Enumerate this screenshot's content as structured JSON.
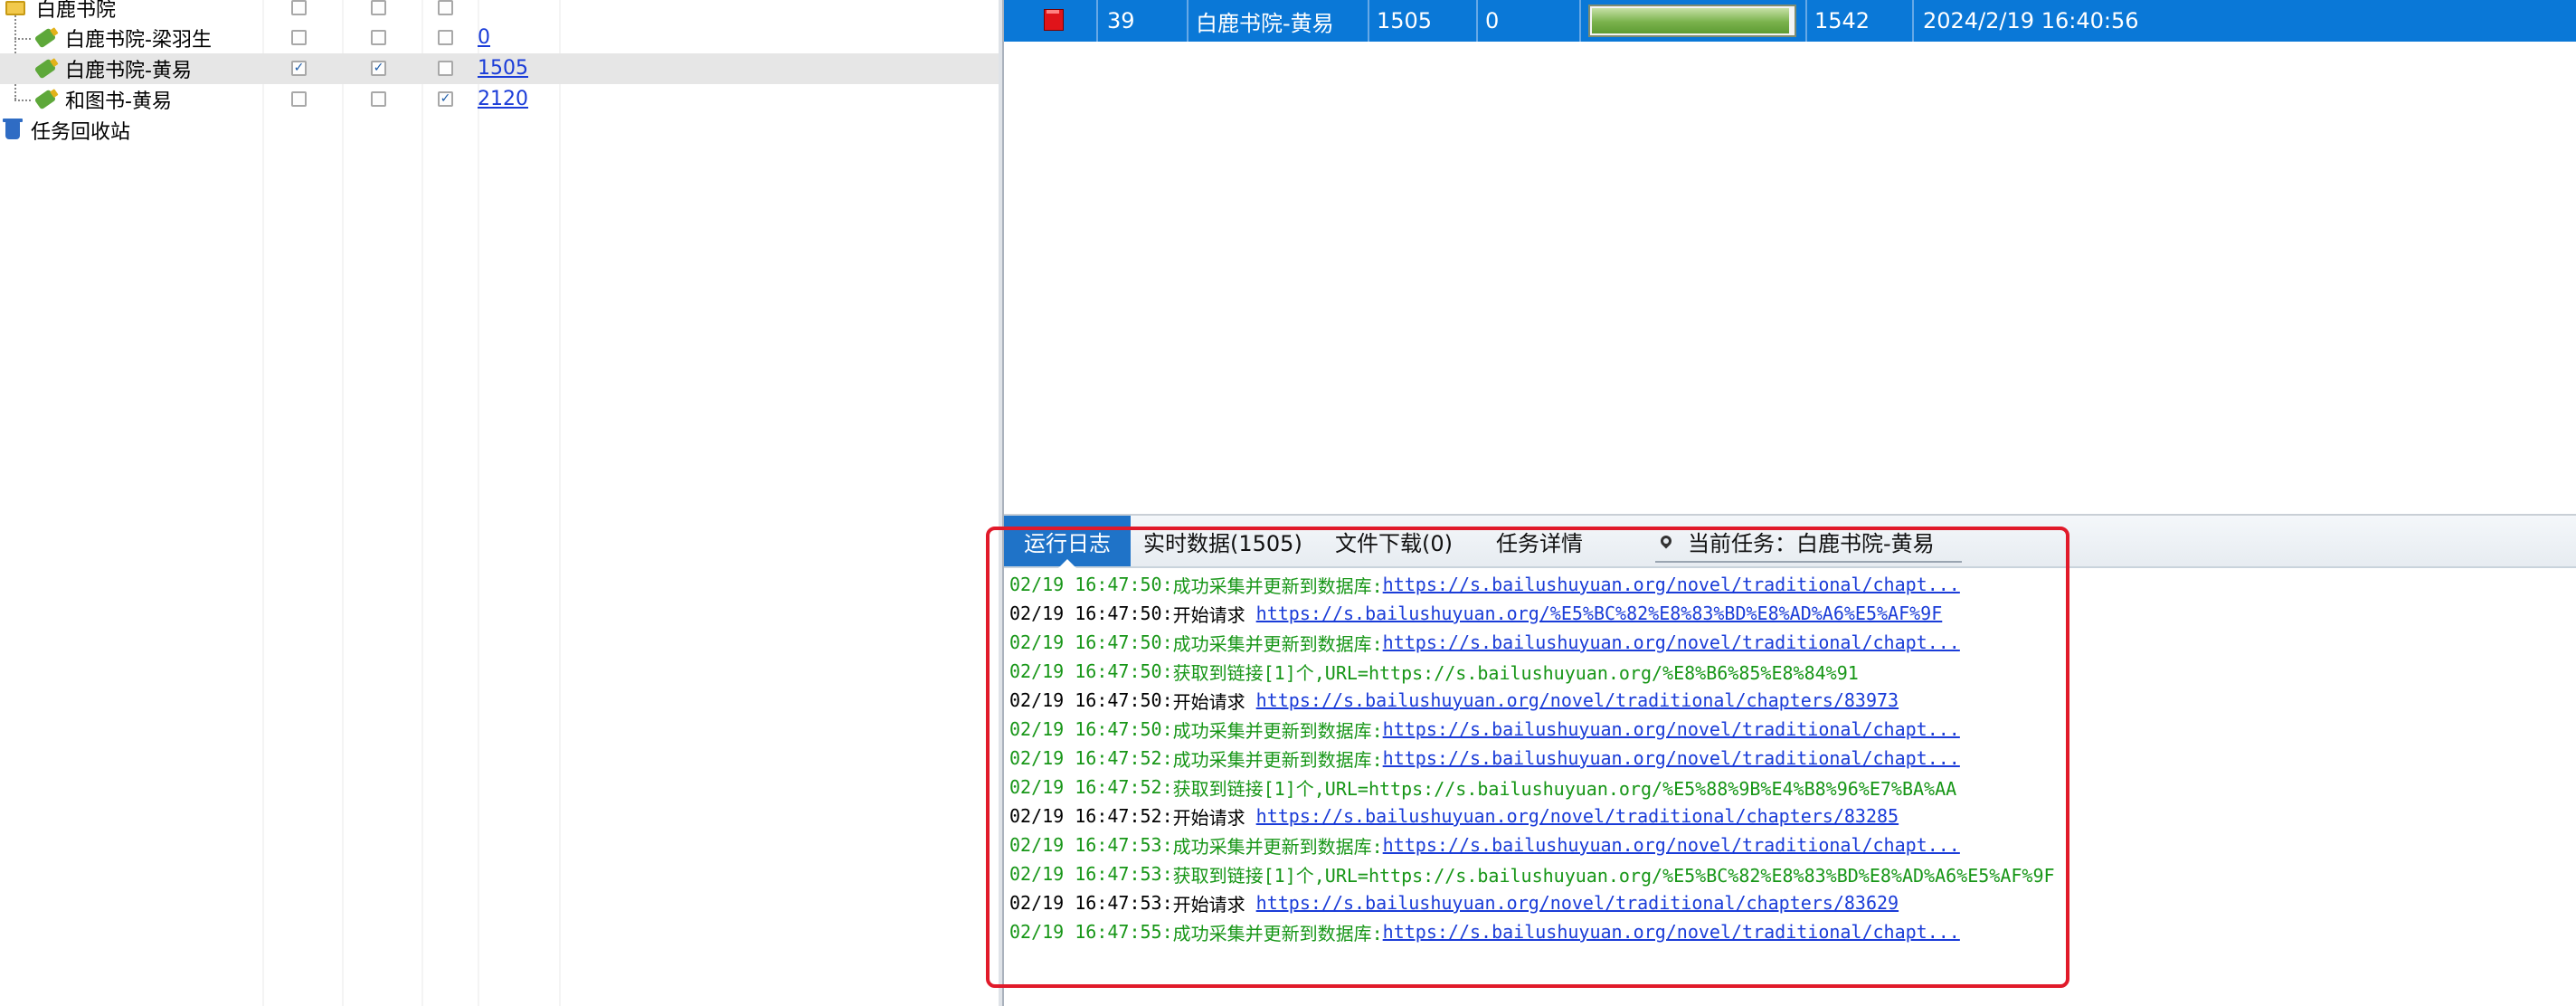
{
  "tree": {
    "nodes": [
      {
        "label": "白鹿书院",
        "icon": "folder-icon",
        "checks": [
          false,
          false,
          false
        ],
        "count": ""
      },
      {
        "label": "白鹿书院-梁羽生",
        "icon": "task-icon",
        "checks": [
          false,
          false,
          false
        ],
        "count": "0"
      },
      {
        "label": "白鹿书院-黄易",
        "icon": "task-icon",
        "checks": [
          true,
          true,
          false
        ],
        "count": "1505",
        "selected": true
      },
      {
        "label": "和图书-黄易",
        "icon": "task-icon",
        "checks": [
          false,
          false,
          true
        ],
        "count": "2120"
      },
      {
        "label": "任务回收站",
        "icon": "recycle-bin-icon",
        "checks": null,
        "count": ""
      }
    ]
  },
  "grid": {
    "row": {
      "status_icon": "stop-icon",
      "id": "39",
      "task": "白鹿书院-黄易",
      "collected": "1505",
      "failed": "0",
      "progress": 0.98,
      "total": "1542",
      "time": "2024/2/19 16:40:56"
    }
  },
  "tabs": {
    "items": [
      "运行日志",
      "实时数据(1505)",
      "文件下载(0)",
      "任务详情"
    ],
    "active": 0,
    "current_task": "当前任务：白鹿书院-黄易"
  },
  "log": {
    "lines": [
      {
        "color": "green",
        "time": "02/19 16:47:50:",
        "msg": "成功采集并更新到数据库:",
        "link": "https://s.bailushuyuan.org/novel/traditional/chapt...",
        "rest": ""
      },
      {
        "color": "black",
        "time": "02/19 16:47:50:",
        "msg": "开始请求 ",
        "link": "https://s.bailushuyuan.org/%E5%BC%82%E8%83%BD%E8%AD%A6%E5%AF%9F",
        "rest": ""
      },
      {
        "color": "green",
        "time": "02/19 16:47:50:",
        "msg": "成功采集并更新到数据库:",
        "link": "https://s.bailushuyuan.org/novel/traditional/chapt...",
        "rest": ""
      },
      {
        "color": "green",
        "time": "02/19 16:47:50:",
        "msg": "获取到链接[1]个,URL=https://s.bailushuyuan.org/%E8%B6%85%E8%84%91",
        "link": "",
        "rest": ""
      },
      {
        "color": "black",
        "time": "02/19 16:47:50:",
        "msg": "开始请求 ",
        "link": "https://s.bailushuyuan.org/novel/traditional/chapters/83973",
        "rest": ""
      },
      {
        "color": "green",
        "time": "02/19 16:47:50:",
        "msg": "成功采集并更新到数据库:",
        "link": "https://s.bailushuyuan.org/novel/traditional/chapt...",
        "rest": ""
      },
      {
        "color": "green",
        "time": "02/19 16:47:52:",
        "msg": "成功采集并更新到数据库:",
        "link": "https://s.bailushuyuan.org/novel/traditional/chapt...",
        "rest": ""
      },
      {
        "color": "green",
        "time": "02/19 16:47:52:",
        "msg": "获取到链接[1]个,URL=https://s.bailushuyuan.org/%E5%88%9B%E4%B8%96%E7%BA%AA",
        "link": "",
        "rest": ""
      },
      {
        "color": "black",
        "time": "02/19 16:47:52:",
        "msg": "开始请求 ",
        "link": "https://s.bailushuyuan.org/novel/traditional/chapters/83285",
        "rest": ""
      },
      {
        "color": "green",
        "time": "02/19 16:47:53:",
        "msg": "成功采集并更新到数据库:",
        "link": "https://s.bailushuyuan.org/novel/traditional/chapt...",
        "rest": ""
      },
      {
        "color": "green",
        "time": "02/19 16:47:53:",
        "msg": "获取到链接[1]个,URL=https://s.bailushuyuan.org/%E5%BC%82%E8%83%BD%E8%AD%A6%E5%AF%9F",
        "link": "",
        "rest": ""
      },
      {
        "color": "black",
        "time": "02/19 16:47:53:",
        "msg": "开始请求 ",
        "link": "https://s.bailushuyuan.org/novel/traditional/chapters/83629",
        "rest": ""
      },
      {
        "color": "green",
        "time": "02/19 16:47:55:",
        "msg": "成功采集并更新到数据库:",
        "link": "https://s.bailushuyuan.org/novel/traditional/chapt...",
        "rest": ""
      }
    ]
  },
  "colors": {
    "selection_blue": "#0a78d7",
    "log_green": "#179617",
    "link_blue": "#1a3cd8",
    "highlight_red": "#e11a2a"
  }
}
